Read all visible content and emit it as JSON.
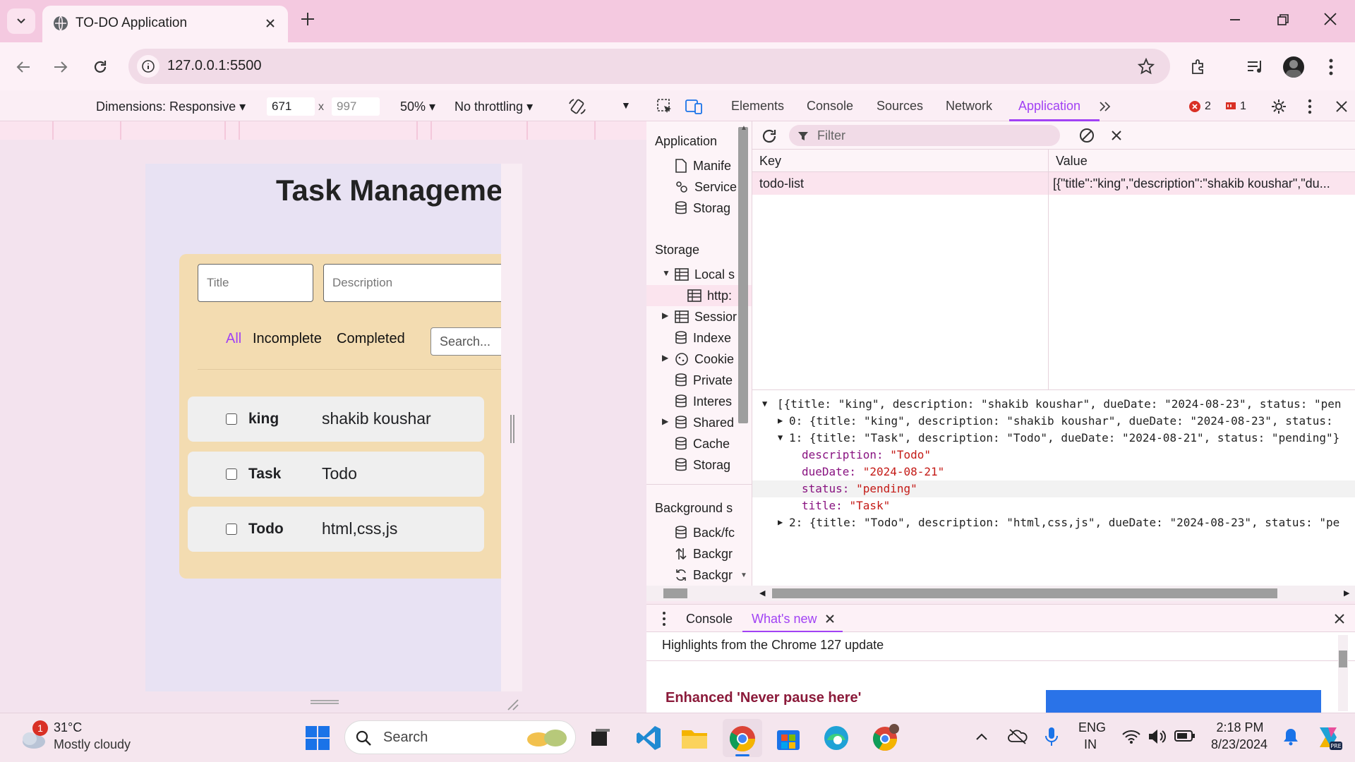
{
  "browser": {
    "tab_title": "TO-DO Application",
    "url": "127.0.0.1:5500"
  },
  "device_toolbar": {
    "dimensions_label": "Dimensions: Responsive",
    "width": "671",
    "x_sep": "x",
    "height": "997",
    "zoom": "50%",
    "throttling": "No throttling"
  },
  "app": {
    "title": "Task Manageme",
    "title_placeholder": "Title",
    "description_placeholder": "Description",
    "filters": [
      "All",
      "Incomplete",
      "Completed"
    ],
    "search_placeholder": "Search...",
    "tasks": [
      {
        "title": "king",
        "description": "shakib koushar"
      },
      {
        "title": "Task",
        "description": "Todo"
      },
      {
        "title": "Todo",
        "description": "html,css,js"
      }
    ]
  },
  "devtools": {
    "tabs": [
      "Elements",
      "Console",
      "Sources",
      "Network",
      "Application"
    ],
    "error_count": "2",
    "issue_count": "1",
    "sidebar": {
      "application_header": "Application",
      "application_items": [
        "Manife",
        "Service",
        "Storag"
      ],
      "storage_header": "Storage",
      "storage_items": [
        "Local s",
        "http:",
        "Sessior",
        "Indexe",
        "Cookie",
        "Private",
        "Interes",
        "Shared",
        "Cache",
        "Storag"
      ],
      "background_header": "Background s",
      "background_items": [
        "Back/fc",
        "Backgr",
        "Backgr"
      ]
    },
    "filter_placeholder": "Filter",
    "table": {
      "key_header": "Key",
      "value_header": "Value",
      "row_key": "todo-list",
      "row_value": "[{\"title\":\"king\",\"description\":\"shakib koushar\",\"du..."
    },
    "json_lines": {
      "root": "[{title: \"king\", description: \"shakib koushar\", dueDate: \"2024-08-23\", status: \"pen",
      "item0": "0: {title: \"king\", description: \"shakib koushar\", dueDate: \"2024-08-23\", status:",
      "item1": "1: {title: \"Task\", description: \"Todo\", dueDate: \"2024-08-21\", status: \"pending\"}",
      "desc_key": "description:",
      "desc_val": "\"Todo\"",
      "due_key": "dueDate:",
      "due_val": "\"2024-08-21\"",
      "status_key": "status:",
      "status_val": "\"pending\"",
      "title_key": "title:",
      "title_val": "\"Task\"",
      "item2": "2: {title: \"Todo\", description: \"html,css,js\", dueDate: \"2024-08-23\", status: \"pe"
    },
    "drawer": {
      "tabs": [
        "Console",
        "What's new"
      ],
      "highlights": "Highlights from the Chrome 127 update",
      "feature_title": "Enhanced 'Never pause here'"
    }
  },
  "taskbar": {
    "weather_temp": "31°C",
    "weather_desc": "Mostly cloudy",
    "weather_badge": "1",
    "search_label": "Search",
    "lang_top": "ENG",
    "lang_bottom": "IN",
    "time": "2:18 PM",
    "date": "8/23/2024"
  },
  "colors": {
    "accent": "#a142f4",
    "card": "#f3dcb1",
    "error": "#d93025"
  }
}
